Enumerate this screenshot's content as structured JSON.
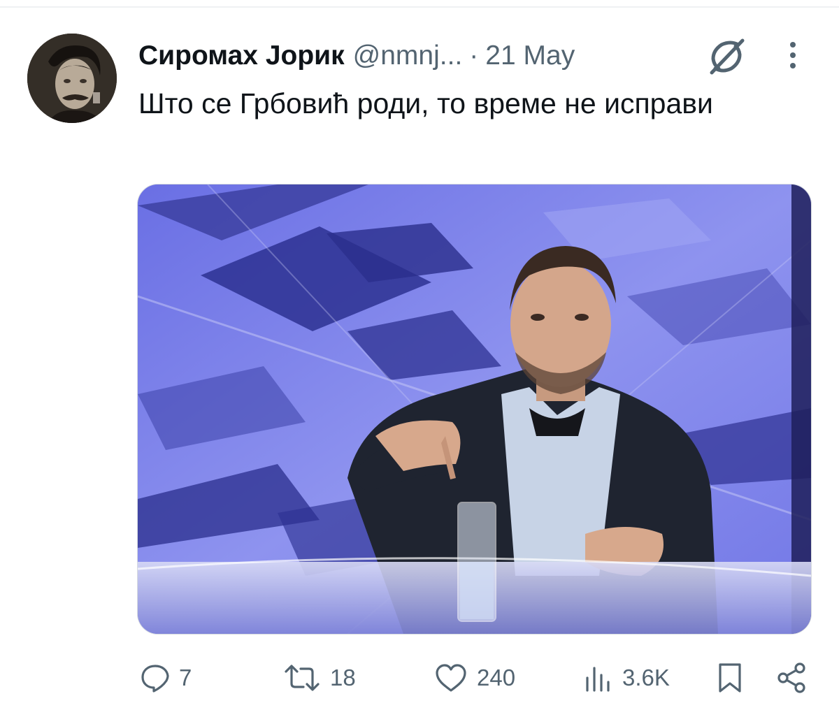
{
  "tweet": {
    "author_name": "Сиромах Јорик",
    "handle": "@nmnj...",
    "separator": "·",
    "date": "21 May",
    "text": "Што се Грбовић роди, то време не исправи"
  },
  "actions": {
    "replies": "7",
    "retweets": "18",
    "likes": "240",
    "views": "3.6K"
  },
  "icons": [
    "grok-icon",
    "more-icon",
    "reply-icon",
    "retweet-icon",
    "like-icon",
    "views-icon",
    "bookmark-icon",
    "share-icon"
  ],
  "colors": {
    "text": "#0f1419",
    "secondary": "#536471",
    "media_background": "#6f74e6"
  }
}
